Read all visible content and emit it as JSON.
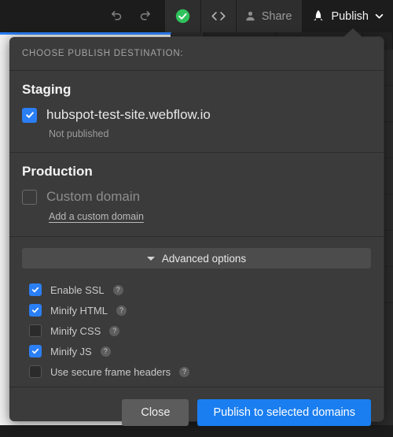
{
  "toolbar": {
    "undo": {
      "name": "undo-icon",
      "tooltip": "Undo"
    },
    "redo": {
      "name": "redo-icon",
      "tooltip": "Redo"
    },
    "status": {
      "name": "saved-check-icon",
      "color": "#2fc25b"
    },
    "code": {
      "name": "code-icon",
      "label": "< >"
    },
    "share": {
      "label": "Share",
      "icon": "person-icon"
    },
    "publish": {
      "label": "Publish",
      "icon": "rocket-icon",
      "chevron": "chevron-down-icon"
    }
  },
  "dropdown": {
    "header": "CHOOSE PUBLISH DESTINATION:",
    "staging": {
      "title": "Staging",
      "domain": "hubspot-test-site.webflow.io",
      "checked": true,
      "status": "Not published"
    },
    "production": {
      "title": "Production",
      "domain": "Custom domain",
      "checked": false,
      "link": "Add a custom domain"
    },
    "advanced": {
      "label": "Advanced options",
      "expanded": true,
      "options": [
        {
          "label": "Enable SSL",
          "checked": true,
          "help": "?"
        },
        {
          "label": "Minify HTML",
          "checked": true,
          "help": "?"
        },
        {
          "label": "Minify CSS",
          "checked": false,
          "help": "?"
        },
        {
          "label": "Minify JS",
          "checked": true,
          "help": "?"
        },
        {
          "label": "Use secure frame headers",
          "checked": false,
          "help": "?"
        }
      ]
    },
    "footer": {
      "close_label": "Close",
      "publish_label": "Publish to selected domains"
    }
  },
  "colors": {
    "accent_blue": "#2b7ff5",
    "publish_button": "#1a7ef0",
    "status_green": "#2fc25b",
    "panel_bg": "#3b3b3b",
    "toolbar_bg": "#1c1c1c"
  }
}
